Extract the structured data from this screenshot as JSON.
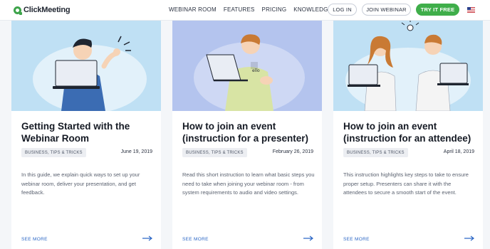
{
  "brand": {
    "name": "ClickMeeting",
    "accent": "#3fae4a",
    "link_color": "#2c67c6"
  },
  "nav": {
    "items": [
      "WEBINAR ROOM",
      "FEATURES",
      "PRICING",
      "KNOWLEDGE BASE"
    ],
    "login": "LOG IN",
    "join": "JOIN WEBINAR",
    "try": "TRY IT FREE",
    "flag_icon": "us-flag-icon"
  },
  "cards": [
    {
      "title": "Getting Started with the Webinar Room",
      "tag": "BUSINESS, TIPS & TRICKS",
      "date": "June 19, 2019",
      "description": "In this guide, we explain quick ways to set up your webinar room, deliver your presentation, and get feedback.",
      "see_more": "SEE MORE",
      "image_bg": "#bfe0f4"
    },
    {
      "title": "How to join an event (instruction for a presenter)",
      "tag": "BUSINESS, TIPS & TRICKS",
      "date": "February 26, 2019",
      "description": "Read this short instruction to learn what basic steps you need to take when joining your webinar room - from system requirements to audio and video settings.",
      "see_more": "SEE MORE",
      "image_bg": "#b4c4ee"
    },
    {
      "title": "How to join an event (instruction for an attendee)",
      "tag": "BUSINESS, TIPS & TRICKS",
      "date": "April 18, 2019",
      "description": "This instruction highlights key steps to take to ensure proper setup. Presenters can share it with the attendees to secure a smooth start of the event.",
      "see_more": "SEE MORE",
      "image_bg": "#bfe0f4"
    }
  ]
}
